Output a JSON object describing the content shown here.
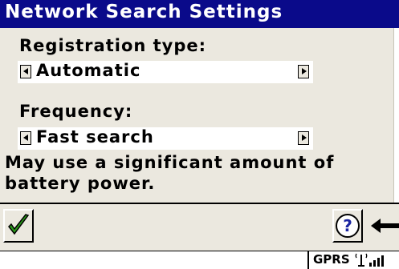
{
  "window": {
    "title": "Network Search Settings"
  },
  "registration": {
    "label": "Registration type:",
    "value": "Automatic"
  },
  "frequency": {
    "label": "Frequency:",
    "value": "Fast search"
  },
  "note": "May use a significant amount of battery power.",
  "toolbar": {
    "ok_icon": "checkmark-icon",
    "help_icon": "question-mark-icon",
    "back_icon": "back-arrow-icon"
  },
  "status": {
    "network": "GPRS",
    "signal_icon": "signal-strength-icon"
  },
  "colors": {
    "titlebar": "#0a0a8a",
    "panel": "#ebe8df",
    "checkmark": "#2a9a1a",
    "help": "#1a24a0"
  }
}
